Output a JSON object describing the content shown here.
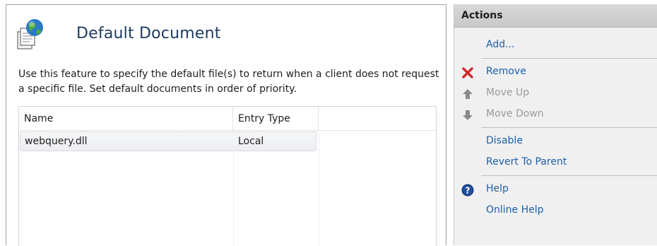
{
  "feature": {
    "title": "Default Document",
    "description": "Use this feature to specify the default file(s) to return when a client does not request a specific file. Set default documents in order of priority.",
    "columns": [
      "Name",
      "Entry Type"
    ],
    "rows": [
      {
        "name": "webquery.dll",
        "entry_type": "Local"
      }
    ]
  },
  "actions": {
    "header": "Actions",
    "items": [
      {
        "label": "Add...",
        "icon": "none",
        "state": "enabled"
      },
      {
        "label": "Remove",
        "icon": "red-x-icon",
        "state": "enabled"
      },
      {
        "label": "Move Up",
        "icon": "arrow-up-icon",
        "state": "disabled"
      },
      {
        "label": "Move Down",
        "icon": "arrow-down-icon",
        "state": "disabled"
      },
      {
        "label": "Disable",
        "icon": "none",
        "state": "enabled"
      },
      {
        "label": "Revert To Parent",
        "icon": "none",
        "state": "enabled"
      },
      {
        "label": "Help",
        "icon": "help-icon",
        "state": "enabled"
      },
      {
        "label": "Online Help",
        "icon": "none",
        "state": "enabled"
      }
    ]
  },
  "colors": {
    "link": "#1c5fa8",
    "disabled": "#9a9a9a",
    "remove_icon": "#d4262c",
    "help_icon": "#1f4fa0",
    "title": "#1e3a5f"
  }
}
